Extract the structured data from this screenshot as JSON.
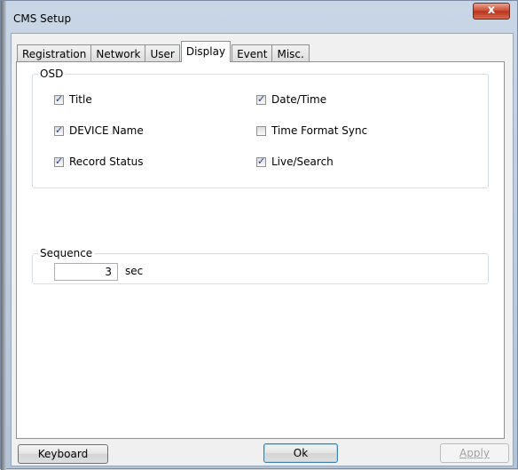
{
  "window": {
    "title": "CMS Setup",
    "close_label": "x"
  },
  "tabs": [
    {
      "label": "Registration"
    },
    {
      "label": "Network"
    },
    {
      "label": "User"
    },
    {
      "label": "Display",
      "active": true
    },
    {
      "label": "Event"
    },
    {
      "label": "Misc."
    }
  ],
  "osd": {
    "label": "OSD",
    "options": [
      {
        "label": "Title",
        "checked": true
      },
      {
        "label": "Date/Time",
        "checked": true
      },
      {
        "label": "DEVICE Name",
        "checked": true
      },
      {
        "label": "Time Format Sync",
        "checked": false
      },
      {
        "label": "Record Status",
        "checked": true
      },
      {
        "label": "Live/Search",
        "checked": true
      }
    ]
  },
  "sequence": {
    "label": "Sequence",
    "value": "3",
    "unit": "sec"
  },
  "buttons": {
    "keyboard": "Keyboard",
    "ok": "Ok",
    "apply": "Apply"
  }
}
